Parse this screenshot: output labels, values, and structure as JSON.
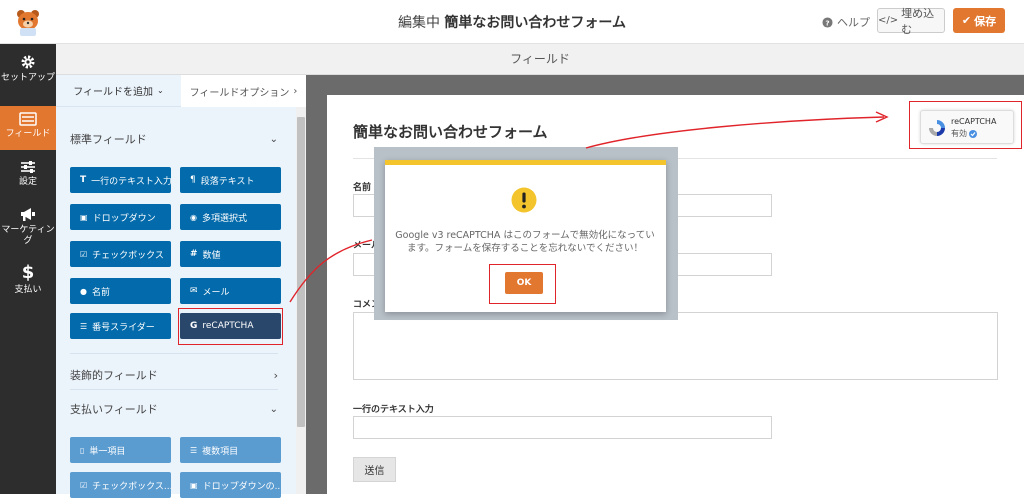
{
  "header": {
    "title_prefix": "編集中",
    "title_name": "簡単なお問い合わせフォーム",
    "help_label": "ヘルプ",
    "embed_label": "埋め込む",
    "save_label": "保存",
    "accent_color": "#e27730"
  },
  "leftnav": {
    "items": [
      {
        "label": "セットアップ",
        "icon": "gear-icon"
      },
      {
        "label": "フィールド",
        "icon": "fields-icon",
        "active": true
      },
      {
        "label": "設定",
        "icon": "sliders-icon"
      },
      {
        "label": "マーケティング",
        "icon": "megaphone-icon"
      },
      {
        "label": "支払い",
        "icon": "dollar-icon"
      }
    ]
  },
  "section_title": "フィールド",
  "panel": {
    "tabs": [
      {
        "label": "フィールドを追加"
      },
      {
        "label": "フィールドオプション"
      }
    ],
    "groups": [
      {
        "label": "標準フィールド"
      },
      {
        "label": "装飾的フィールド"
      },
      {
        "label": "支払いフィールド"
      }
    ],
    "standard_fields": [
      {
        "label": "一行のテキスト入力",
        "icon": "text-icon"
      },
      {
        "label": "段落テキスト",
        "icon": "paragraph-icon"
      },
      {
        "label": "ドロップダウン",
        "icon": "dropdown-icon"
      },
      {
        "label": "多項選択式",
        "icon": "radio-icon"
      },
      {
        "label": "チェックボックス",
        "icon": "checkbox-icon"
      },
      {
        "label": "数値",
        "icon": "hash-icon"
      },
      {
        "label": "名前",
        "icon": "user-icon"
      },
      {
        "label": "メール",
        "icon": "mail-icon"
      },
      {
        "label": "番号スライダー",
        "icon": "slider-icon"
      },
      {
        "label": "reCAPTCHA",
        "icon": "google-icon"
      }
    ],
    "payment_fields": [
      {
        "label": "単一項目",
        "icon": "file-icon"
      },
      {
        "label": "複数項目",
        "icon": "list-icon"
      },
      {
        "label": "チェックボックス...",
        "icon": "checkbox-icon"
      },
      {
        "label": "ドロップダウンの...",
        "icon": "dropdown-icon"
      }
    ]
  },
  "form": {
    "title": "簡単なお問い合わせフォーム",
    "labels": {
      "name": "名前",
      "email": "メール",
      "comment": "コメン",
      "single_line": "一行のテキスト入力"
    },
    "submit_label": "送信"
  },
  "recaptcha_badge": {
    "name": "reCAPTCHA",
    "status": "有効"
  },
  "modal": {
    "message": "Google v3 reCAPTCHA はこのフォームで無効化になっています。フォームを保存することを忘れないでください！",
    "ok_label": "OK"
  }
}
